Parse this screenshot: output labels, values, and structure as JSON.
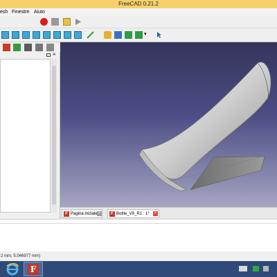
{
  "window": {
    "title": "FreeCAD 0.21.2"
  },
  "menubar": {
    "items": [
      "esh",
      "Finestre",
      "Aiuto"
    ]
  },
  "toolbar": {
    "workbench_combo_value": ""
  },
  "document_tabs": [
    {
      "label": "Pagina iniziale"
    },
    {
      "label": "Bottle_V8_R1 : 1*"
    }
  ],
  "statusbar": {
    "text": "2 mm, 5.046977 mm)"
  },
  "colors": {
    "accent": "#c0392b",
    "titlebar": "#f5d06b",
    "viewport_top": "#34345c",
    "viewport_bottom": "#a6a6c4",
    "taskbar": "#2f4a78"
  },
  "taskbar": {
    "apps": [
      "internet-explorer-icon",
      "freecad-icon"
    ]
  }
}
